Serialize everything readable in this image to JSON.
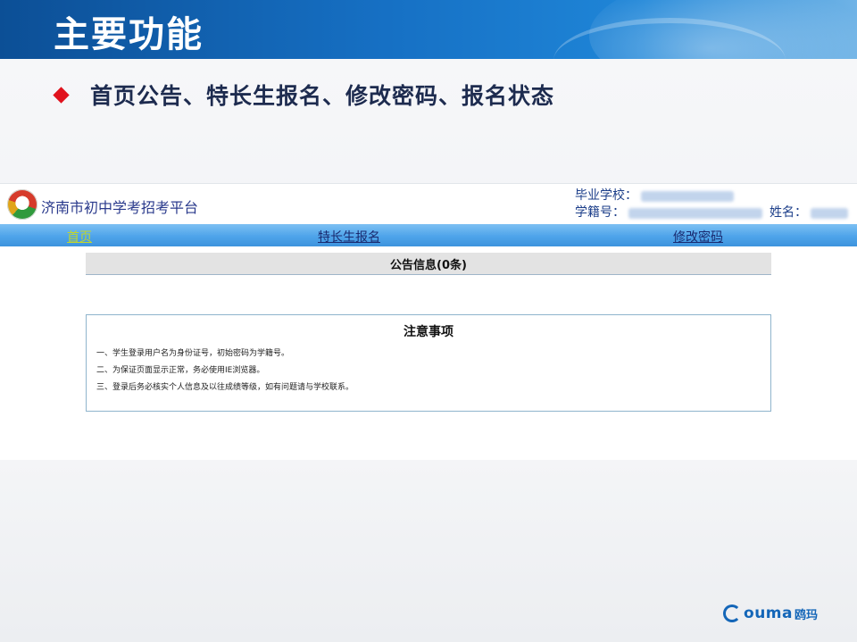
{
  "slide": {
    "title": "主要功能",
    "bullet": "首页公告、特长生报名、修改密码、报名状态"
  },
  "portal": {
    "site_title": "济南市初中学考招考平台",
    "user": {
      "school_label": "毕业学校：",
      "student_id_label": "学籍号：",
      "name_label": "姓名："
    },
    "nav": {
      "home": "首页",
      "special_signup": "特长生报名",
      "change_password": "修改密码"
    },
    "announcement_title": "公告信息(0条)",
    "notes": {
      "title": "注意事项",
      "items": [
        "一、学生登录用户名为身份证号，初始密码为学籍号。",
        "二、为保证页面显示正常，务必使用IE浏览器。",
        "三、登录后务必核实个人信息及以往成绩等级，如有问题请与学校联系。"
      ]
    }
  },
  "footer": {
    "brand": "ouma",
    "brand_cn": "鸥玛"
  },
  "colors": {
    "header_blue": "#1670c4",
    "bullet_red": "#e0121d",
    "nav_blue": "#4ea4ea",
    "nav_home_active": "#c3d62a"
  }
}
